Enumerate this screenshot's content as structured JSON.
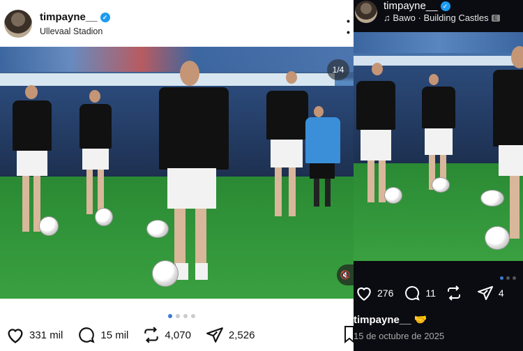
{
  "left_post": {
    "username": "timpayne__",
    "location": "Ullevaal Stadion",
    "more_label": "• •",
    "carousel_counter": "1/4",
    "mute_label": "🔇",
    "pager": {
      "total": 4,
      "active": 0
    },
    "actions": {
      "likes": "331 mil",
      "comments": "15 mil",
      "reposts": "4,070",
      "shares": "2,526"
    }
  },
  "right_post": {
    "username": "timpayne__",
    "music": "Bawo · Building Castles",
    "explicit_badge": "E",
    "pager": {
      "total": 3,
      "active": 0
    },
    "actions": {
      "likes": "276",
      "comments": "11",
      "shares": "4"
    },
    "caption_user": "timpayne__",
    "caption_emoji": "🤝",
    "date": "15 de octubre de 2025"
  },
  "colors": {
    "verified": "#1d9bf0",
    "pager_active": "#3a7bd5",
    "dark_bg": "#0b0b12"
  }
}
